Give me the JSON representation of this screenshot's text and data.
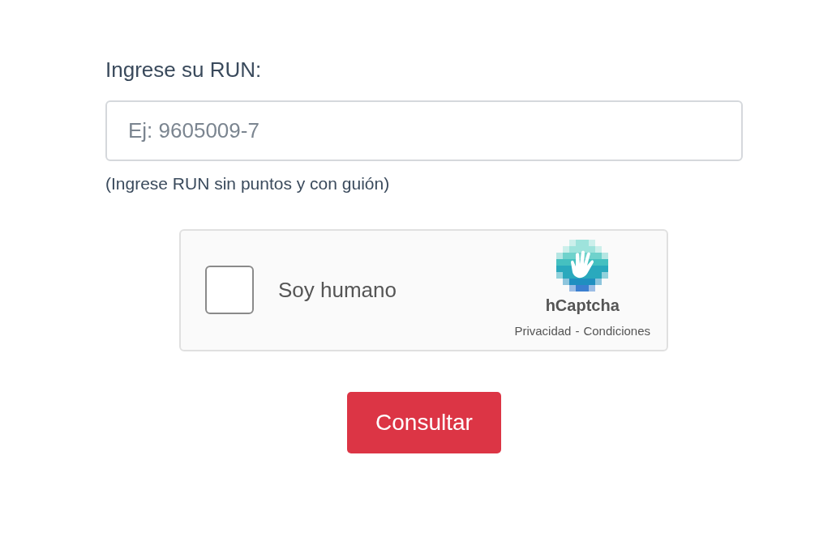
{
  "label": "Ingrese su RUN:",
  "run_field": {
    "placeholder": "Ej: 9605009-7"
  },
  "hint": "(Ingrese RUN sin puntos y con guión)",
  "captcha": {
    "checked": false,
    "label": "Soy humano",
    "brand": "hCaptcha",
    "privacy_link": "Privacidad",
    "separator": "-",
    "terms_link": "Condiciones"
  },
  "submit_button": "Consultar"
}
